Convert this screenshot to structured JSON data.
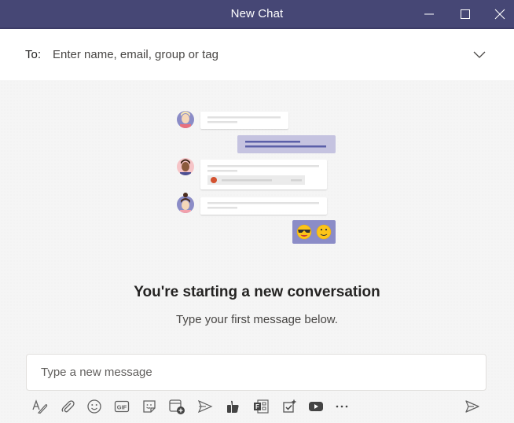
{
  "window": {
    "title": "New Chat",
    "controls": [
      "minimize",
      "maximize",
      "close"
    ]
  },
  "to_bar": {
    "label": "To:",
    "placeholder": "Enter name, email, group or tag",
    "value": ""
  },
  "empty_state": {
    "heading": "You're starting a new conversation",
    "subheading": "Type your first message below."
  },
  "composer": {
    "placeholder": "Type a new message",
    "value": ""
  },
  "toolbar": {
    "items": [
      {
        "name": "format",
        "icon": "format-icon"
      },
      {
        "name": "attach",
        "icon": "paperclip-icon"
      },
      {
        "name": "emoji",
        "icon": "emoji-icon"
      },
      {
        "name": "gif",
        "icon": "gif-icon",
        "glyph": "GIF"
      },
      {
        "name": "sticker",
        "icon": "sticker-icon"
      },
      {
        "name": "schedule-meeting",
        "icon": "meeting-icon"
      },
      {
        "name": "stream",
        "icon": "stream-icon"
      },
      {
        "name": "praise",
        "icon": "praise-icon"
      },
      {
        "name": "forms",
        "icon": "forms-icon"
      },
      {
        "name": "approvals",
        "icon": "approvals-icon"
      },
      {
        "name": "youtube",
        "icon": "youtube-icon"
      },
      {
        "name": "more",
        "icon": "more-icon",
        "glyph": "•••"
      }
    ],
    "send": {
      "icon": "send-icon"
    }
  },
  "colors": {
    "titlebar": "#464775",
    "accent_purple": "#6264a7",
    "light_purple": "#c5c3e0",
    "text_primary": "#252423",
    "text_secondary": "#484644",
    "icon_gray": "#616161"
  }
}
